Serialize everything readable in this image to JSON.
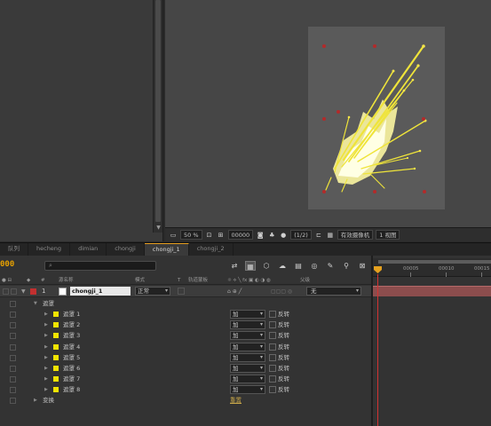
{
  "viewer_toolbar": {
    "zoom": "50 %",
    "timecode": "00000",
    "resolution": "(1/2)",
    "camera": "有效摄像机",
    "views": "1 视图"
  },
  "timeline": {
    "tabs": [
      "队列",
      "hecheng",
      "dimian",
      "chongji",
      "chongji_1",
      "chongji_2"
    ],
    "active_tab": "chongji_1",
    "timecode": "000",
    "search_placeholder": "",
    "columns": {
      "name": "源名称",
      "mode": "模式",
      "t": "T",
      "trkmat": "轨道蒙板",
      "parent": "父级"
    },
    "ruler_labels": [
      "00005",
      "00010",
      "00015"
    ],
    "layer": {
      "index": "1",
      "name": "chongji_1",
      "mode": "正常",
      "parent": "无"
    },
    "masks_group": "遮罩",
    "masks": [
      {
        "name": "遮罩 1",
        "mode": "加",
        "invert": "反转"
      },
      {
        "name": "遮罩 2",
        "mode": "加",
        "invert": "反转"
      },
      {
        "name": "遮罩 3",
        "mode": "加",
        "invert": "反转"
      },
      {
        "name": "遮罩 4",
        "mode": "加",
        "invert": "反转"
      },
      {
        "name": "遮罩 5",
        "mode": "加",
        "invert": "反转"
      },
      {
        "name": "遮罩 6",
        "mode": "加",
        "invert": "反转"
      },
      {
        "name": "遮罩 7",
        "mode": "加",
        "invert": "反转"
      },
      {
        "name": "遮罩 8",
        "mode": "加",
        "invert": "反转"
      }
    ],
    "transform": "变换",
    "reset": "重置"
  },
  "colors": {
    "accent": "#e7a100",
    "playhead": "#d23232",
    "mask_chip": "#f1e400",
    "layer_bar": "#8c4d4d"
  }
}
